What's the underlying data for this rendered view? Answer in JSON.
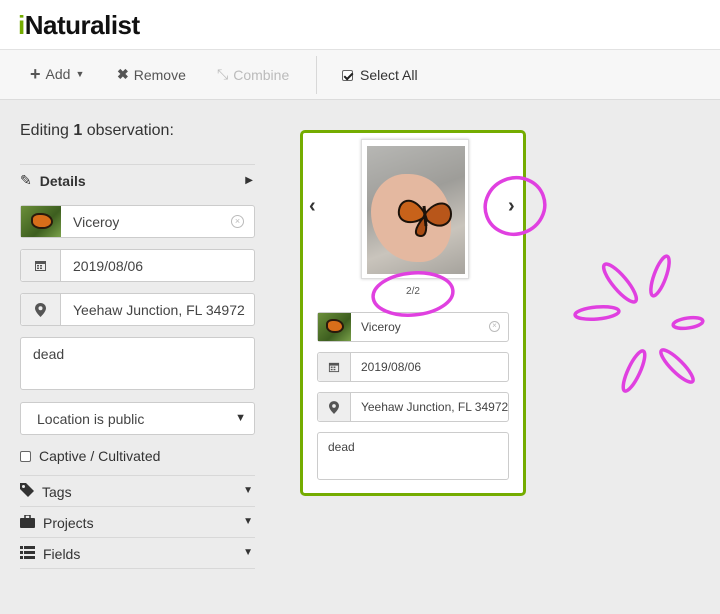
{
  "app": {
    "logo_text": "Naturalist",
    "logo_prefix": "i"
  },
  "toolbar": {
    "add_label": "Add",
    "remove_label": "Remove",
    "combine_label": "Combine",
    "select_all_label": "Select All",
    "select_all_checked": true
  },
  "editor": {
    "heading_prefix": "Editing ",
    "count": "1",
    "heading_suffix": " observation:",
    "details_label": "Details",
    "taxon": "Viceroy",
    "date": "2019/08/06",
    "location": "Yeehaw Junction, FL 34972",
    "description": "dead",
    "geoprivacy": "Location is public",
    "captive_label": "Captive / Cultivated",
    "captive_checked": false,
    "sections": [
      "Tags",
      "Projects",
      "Fields"
    ]
  },
  "card": {
    "photo_counter": "2/2",
    "taxon": "Viceroy",
    "date": "2019/08/06",
    "location": "Yeehaw Junction, FL 34972",
    "description": "dead"
  },
  "colors": {
    "accent": "#74ac00",
    "annotation": "#e040e0"
  },
  "icons": [
    "plus-icon",
    "caret-down-icon",
    "times-icon",
    "compress-icon",
    "pencil-icon",
    "caret-right-icon",
    "calendar-icon",
    "map-marker-icon",
    "tag-icon",
    "briefcase-icon",
    "list-icon",
    "chevron-left-icon",
    "chevron-right-icon"
  ]
}
